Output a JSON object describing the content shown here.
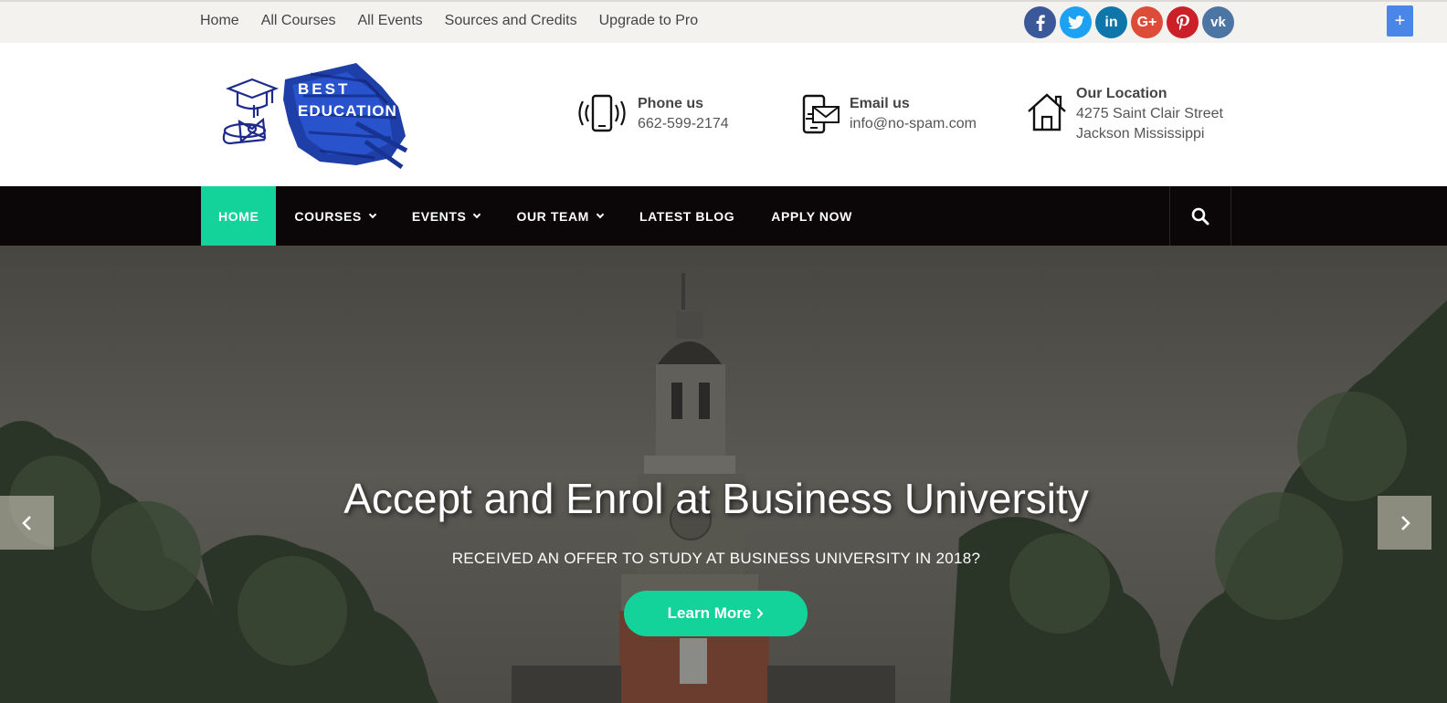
{
  "topbar": {
    "links": [
      "Home",
      "All Courses",
      "All Events",
      "Sources and Credits",
      "Upgrade to Pro"
    ],
    "social": [
      {
        "icon": "facebook-icon",
        "glyph": "f",
        "color": "#3b5998"
      },
      {
        "icon": "twitter-icon",
        "glyph": "t",
        "color": "#1da1f2"
      },
      {
        "icon": "linkedin-icon",
        "glyph": "in",
        "color": "#0e76a8"
      },
      {
        "icon": "google-plus-icon",
        "glyph": "G+",
        "color": "#dd4b39"
      },
      {
        "icon": "pinterest-icon",
        "glyph": "p",
        "color": "#cb2027"
      },
      {
        "icon": "vk-icon",
        "glyph": "vk",
        "color": "#4c75a3"
      }
    ],
    "plus": "+"
  },
  "logo": {
    "line1": "BEST",
    "line2": "EDUCATION"
  },
  "header": {
    "phone": {
      "title": "Phone us",
      "value": "662-599-2174"
    },
    "email": {
      "title": "Email us",
      "value": "info@no-spam.com"
    },
    "location": {
      "title": "Our Location",
      "line1": "4275 Saint Clair Street",
      "line2": "Jackson Mississippi"
    }
  },
  "nav": {
    "items": [
      {
        "label": "HOME",
        "active": true,
        "dropdown": false
      },
      {
        "label": "COURSES",
        "active": false,
        "dropdown": true
      },
      {
        "label": "EVENTS",
        "active": false,
        "dropdown": true
      },
      {
        "label": "OUR TEAM",
        "active": false,
        "dropdown": true
      },
      {
        "label": "LATEST BLOG",
        "active": false,
        "dropdown": false
      },
      {
        "label": "APPLY NOW",
        "active": false,
        "dropdown": false
      }
    ]
  },
  "hero": {
    "title": "Accept and Enrol at Business University",
    "subtitle": "RECEIVED AN OFFER TO STUDY AT BUSINESS UNIVERSITY IN 2018?",
    "button": "Learn More"
  },
  "colors": {
    "accent": "#14d39a",
    "nav_bg": "#0b0708",
    "topbar_bg": "#f3f2ef"
  }
}
